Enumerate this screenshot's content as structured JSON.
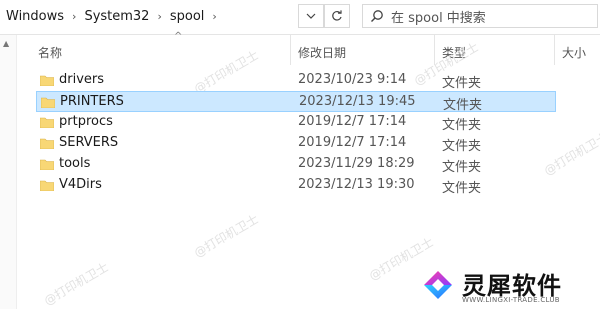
{
  "address_bar": {
    "breadcrumbs": [
      "Windows",
      "System32",
      "spool"
    ],
    "separator": "›"
  },
  "search": {
    "placeholder": "在 spool 中搜索"
  },
  "columns": {
    "name": "名称",
    "date": "修改日期",
    "type": "类型",
    "size": "大小"
  },
  "rows": [
    {
      "name": "drivers",
      "date": "2023/10/23 9:14",
      "type": "文件夹",
      "selected": false
    },
    {
      "name": "PRINTERS",
      "date": "2023/12/13 19:45",
      "type": "文件夹",
      "selected": true
    },
    {
      "name": "prtprocs",
      "date": "2019/12/7 17:14",
      "type": "文件夹",
      "selected": false
    },
    {
      "name": "SERVERS",
      "date": "2019/12/7 17:14",
      "type": "文件夹",
      "selected": false
    },
    {
      "name": "tools",
      "date": "2023/11/29 18:29",
      "type": "文件夹",
      "selected": false
    },
    {
      "name": "V4Dirs",
      "date": "2023/12/13 19:30",
      "type": "文件夹",
      "selected": false
    }
  ],
  "watermark": "@打印机卫士",
  "brand": {
    "name": "灵犀软件",
    "url": "WWW.LINGXI-TRADE.CLUB"
  },
  "colors": {
    "selection_bg": "#cce8ff",
    "selection_border": "#99d1ff",
    "folder": "#f8d775"
  }
}
